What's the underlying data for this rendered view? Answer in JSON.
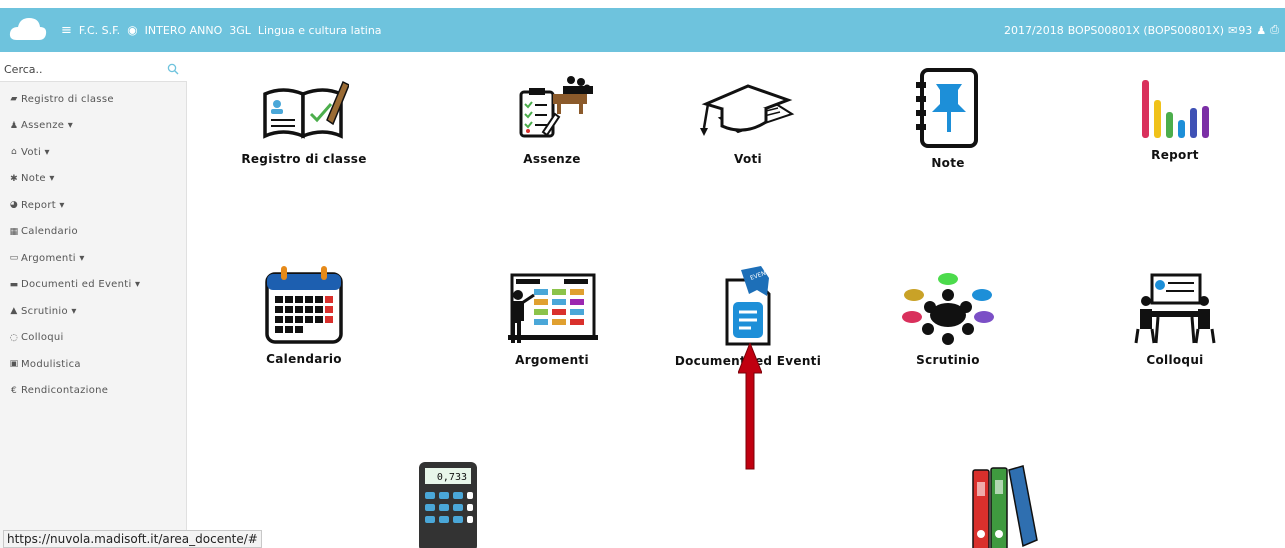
{
  "topbar": {
    "menu_icon": "hamburger-icon",
    "user": "F.C. S.F.",
    "eye_icon": "eye-icon",
    "period": "INTERO ANNO",
    "class": "3GL",
    "subject": "Lingua e cultura latina",
    "year": "2017/2018",
    "school": "BOPS00801X (BOPS00801X)",
    "mail_icon": "envelope-icon",
    "mail_count": "93",
    "user_icon": "user-icon",
    "print_icon": "print-icon",
    "bg_color": "#6ec3dd"
  },
  "sidebar": {
    "search_placeholder": "Cerca..",
    "items": [
      {
        "icon": "book-icon",
        "glyph": "▰",
        "label": "Registro di classe"
      },
      {
        "icon": "user-icon",
        "glyph": "♟",
        "label": "Assenze ▾"
      },
      {
        "icon": "bank-icon",
        "glyph": "⌂",
        "label": "Voti ▾"
      },
      {
        "icon": "pin-icon",
        "glyph": "✱",
        "label": "Note ▾"
      },
      {
        "icon": "pie-chart-icon",
        "glyph": "◕",
        "label": "Report ▾"
      },
      {
        "icon": "calendar-icon",
        "glyph": "▦",
        "label": "Calendario"
      },
      {
        "icon": "folder-open-icon",
        "glyph": "▭",
        "label": "Argomenti ▾"
      },
      {
        "icon": "inbox-icon",
        "glyph": "▬",
        "label": "Documenti ed Eventi ▾"
      },
      {
        "icon": "graduation-cap-icon",
        "glyph": "▲",
        "label": "Scrutinio ▾"
      },
      {
        "icon": "comments-icon",
        "glyph": "◌",
        "label": "Colloqui"
      },
      {
        "icon": "briefcase-icon",
        "glyph": "▣",
        "label": "Modulistica"
      },
      {
        "icon": "euro-icon",
        "glyph": "€",
        "label": "Rendicontazione"
      }
    ]
  },
  "tiles": [
    {
      "label": "Registro di classe"
    },
    {
      "label": "Assenze"
    },
    {
      "label": "Voti"
    },
    {
      "label": "Note"
    },
    {
      "label": "Report"
    },
    {
      "label": "Calendario"
    },
    {
      "label": "Argomenti"
    },
    {
      "label": "Documenti ed Eventi"
    },
    {
      "label": "Scrutinio"
    },
    {
      "label": "Colloqui"
    }
  ],
  "calculator_display": "0,733",
  "document_badge": "EVENT",
  "status_url": "https://nuvola.madisoft.it/area_docente/#"
}
